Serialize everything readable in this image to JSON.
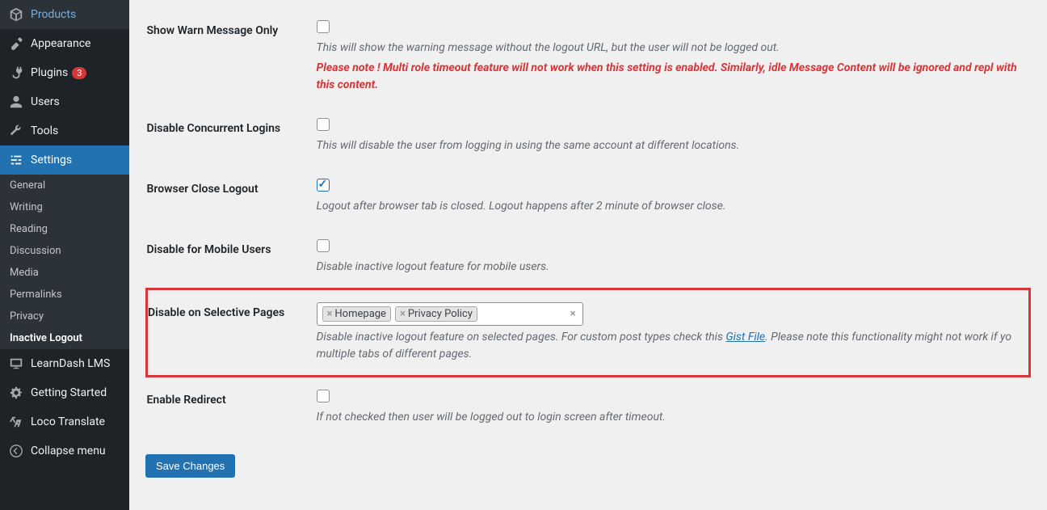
{
  "sidebar": {
    "products": "Products",
    "appearance": "Appearance",
    "plugins": "Plugins",
    "plugins_badge": "3",
    "users": "Users",
    "tools": "Tools",
    "settings": "Settings",
    "submenu": {
      "general": "General",
      "writing": "Writing",
      "reading": "Reading",
      "discussion": "Discussion",
      "media": "Media",
      "permalinks": "Permalinks",
      "privacy": "Privacy",
      "inactive_logout": "Inactive Logout"
    },
    "learndash": "LearnDash LMS",
    "getting_started": "Getting Started",
    "loco": "Loco Translate",
    "collapse": "Collapse menu"
  },
  "settings_rows": {
    "warn": {
      "label": "Show Warn Message Only",
      "desc": "This will show the warning message without the logout URL, but the user will not be logged out.",
      "note": "Please note ! Multi role timeout feature will not work when this setting is enabled. Similarly, idle Message Content will be ignored and repl with this content."
    },
    "concurrent": {
      "label": "Disable Concurrent Logins",
      "desc": "This will disable the user from logging in using the same account at different locations."
    },
    "browser_close": {
      "label": "Browser Close Logout",
      "desc": "Logout after browser tab is closed. Logout happens after 2 minute of browser close."
    },
    "mobile": {
      "label": "Disable for Mobile Users",
      "desc": "Disable inactive logout feature for mobile users."
    },
    "selective": {
      "label": "Disable on Selective Pages",
      "tags": [
        "Homepage",
        "Privacy Policy"
      ],
      "desc_pre": "Disable inactive logout feature on selected pages. For custom post types check this ",
      "link": "Gist File",
      "desc_post": ". Please note this functionality might not work if yo multiple tabs of different pages."
    },
    "redirect": {
      "label": "Enable Redirect",
      "desc": "If not checked then user will be logged out to login screen after timeout."
    }
  },
  "save_button": "Save Changes"
}
